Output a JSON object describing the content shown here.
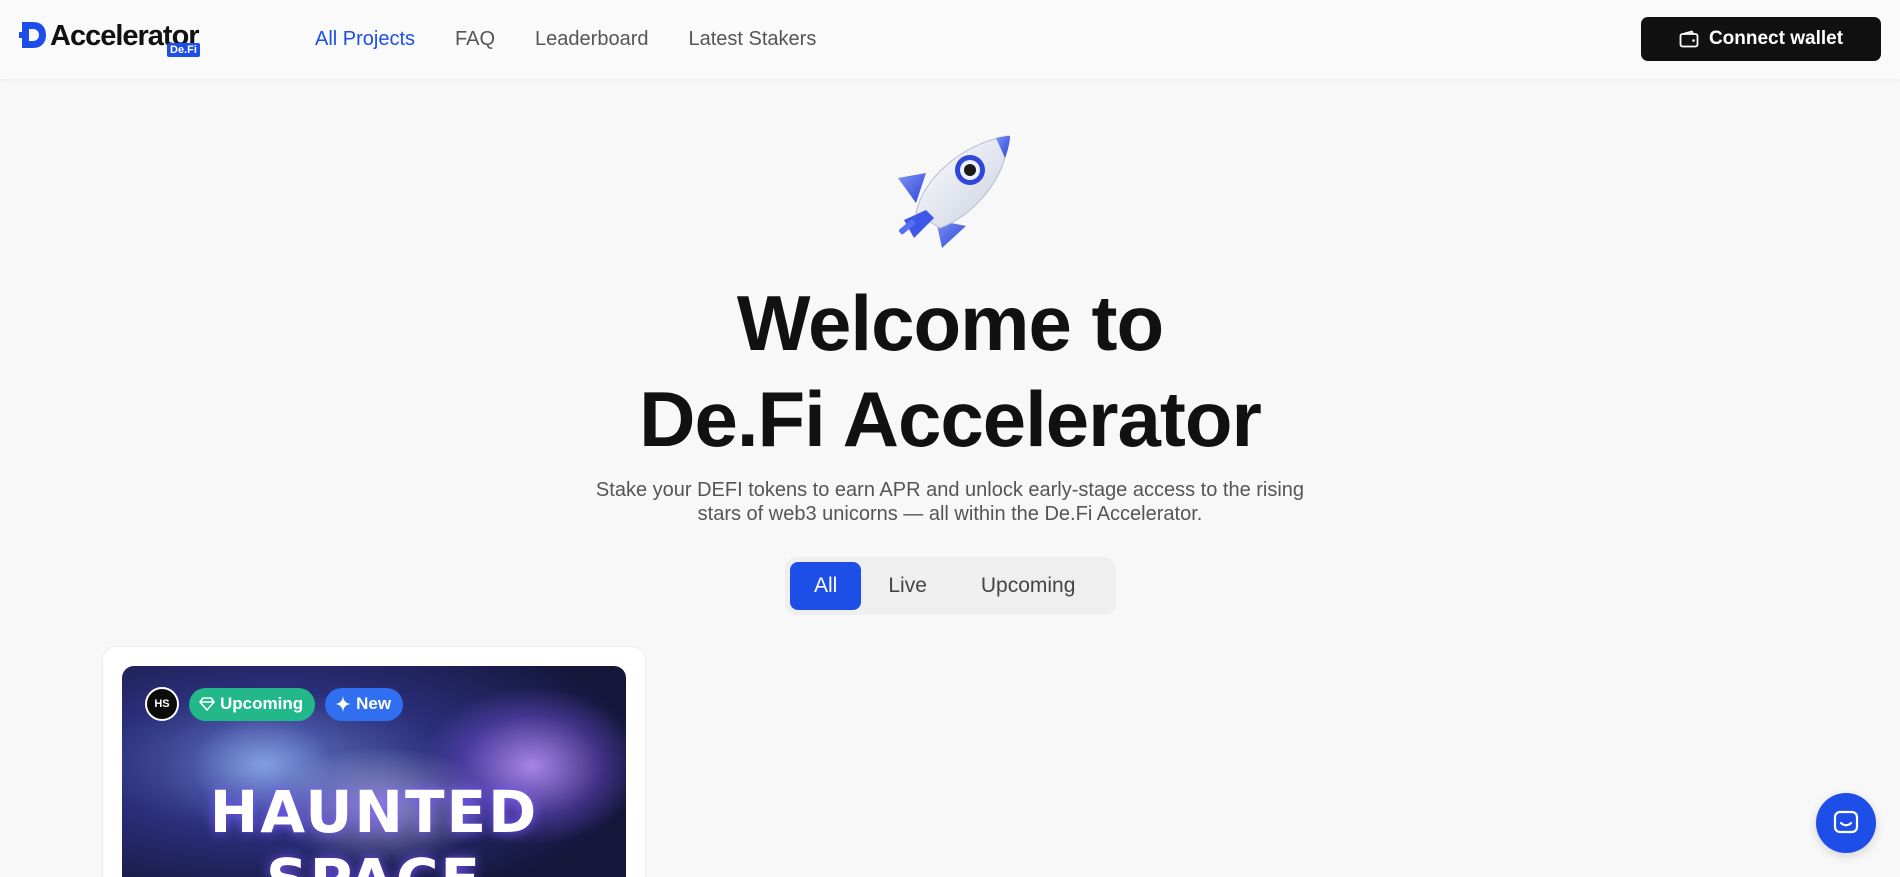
{
  "header": {
    "logo_text": "Accelerator",
    "logo_badge": "De.Fi",
    "nav": [
      {
        "label": "All Projects",
        "active": true
      },
      {
        "label": "FAQ",
        "active": false
      },
      {
        "label": "Leaderboard",
        "active": false
      },
      {
        "label": "Latest Stakers",
        "active": false
      }
    ],
    "connect_label": "Connect wallet"
  },
  "hero": {
    "title_line1": "Welcome to",
    "title_line2": "De.Fi Accelerator",
    "subtitle": "Stake your DEFI tokens to earn APR and unlock early-stage access to the rising stars of web3 unicorns — all within the De.Fi Accelerator.",
    "rocket_icon": "rocket-icon"
  },
  "filters": {
    "tabs": [
      {
        "label": "All",
        "active": true
      },
      {
        "label": "Live",
        "active": false
      },
      {
        "label": "Upcoming",
        "active": false
      }
    ]
  },
  "projects": [
    {
      "image_title": "HAUNTED SPACE",
      "avatar_text": "HS",
      "status_badge": "Upcoming",
      "new_badge": "New"
    }
  ],
  "colors": {
    "accent": "#1d4fe8",
    "upcoming": "#22b88a",
    "new": "#2f6ff0",
    "dark_button": "#111111"
  }
}
